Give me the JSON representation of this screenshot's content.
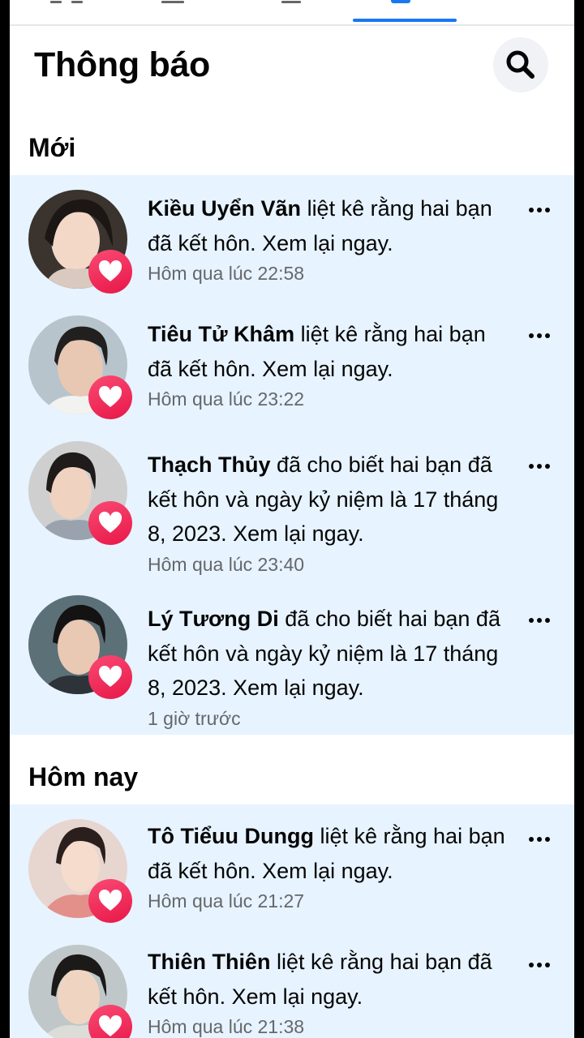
{
  "header": {
    "title": "Thông báo"
  },
  "sections": [
    {
      "title": "Mới"
    },
    {
      "title": "Hôm nay"
    }
  ],
  "notifications": [
    {
      "name": "Kiều Uyển Vãn",
      "message": " liệt kê rằng hai bạn đã kết hôn. Xem lại ngay.",
      "time": "Hôm qua lúc 22:58"
    },
    {
      "name": "Tiêu Tử Khâm",
      "message": " liệt kê rằng hai bạn đã kết hôn. Xem lại ngay.",
      "time": "Hôm qua lúc 23:22"
    },
    {
      "name": "Thạch Thủy",
      "message": " đã cho biết hai bạn đã kết hôn và ngày kỷ niệm là 17 tháng 8, 2023. Xem lại ngay.",
      "time": "Hôm qua lúc 23:40"
    },
    {
      "name": "Lý Tương Di",
      "message": " đã cho biết hai bạn đã kết hôn và ngày kỷ niệm là 17 tháng 8, 2023. Xem lại ngay.",
      "time": "1 giờ trước"
    },
    {
      "name": "Tô Tiểuu Dungg",
      "message": " liệt kê rằng hai bạn đã kết hôn. Xem lại ngay.",
      "time": "Hôm qua lúc 21:27"
    },
    {
      "name": "Thiên Thiên",
      "message": " liệt kê rằng hai bạn đã kết hôn. Xem lại ngay.",
      "time": "Hôm qua lúc 21:38"
    }
  ],
  "colors": {
    "accent": "#1877f2",
    "unread_bg": "#e7f3ff",
    "badge": "#f02849",
    "muted": "#65676b"
  },
  "icons": {
    "search": "search-icon",
    "badge": "heart-icon",
    "more": "more-options-icon"
  }
}
